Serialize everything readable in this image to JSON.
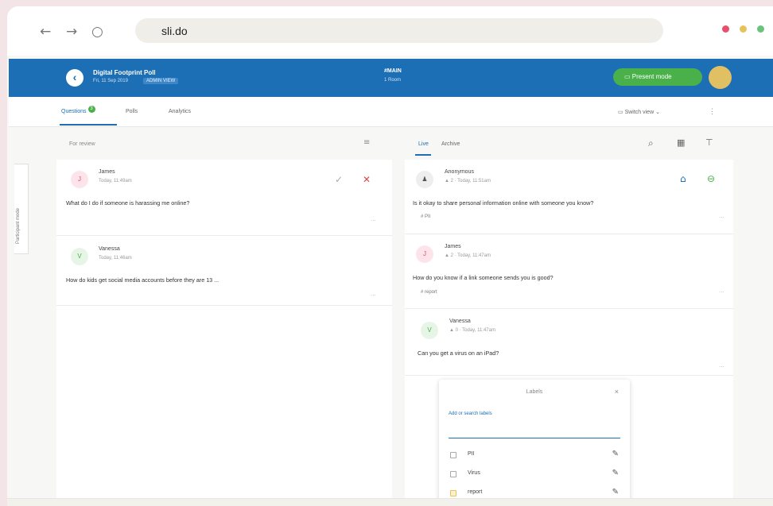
{
  "browser": {
    "url": "sli.do",
    "back_icon": "←",
    "forward_icon": "→",
    "reload_icon": "○",
    "window_dots": [
      "#e8506a",
      "#e6c35a",
      "#69c37a"
    ]
  },
  "header": {
    "event_title": "Digital Footprint Poll",
    "event_date": "Fri, 11 Sep 2019",
    "event_badge": "ADMIN VIEW",
    "event_code": "#MAIN",
    "event_code_sub": "1 Room",
    "present_label": "Present mode",
    "back_icon": "‹"
  },
  "tabs": {
    "questions": "Questions",
    "questions_count": "3",
    "polls": "Polls",
    "analytics": "Analytics",
    "switch_view": "Switch view",
    "more": "⋮"
  },
  "participant_mode": "Participant mode",
  "review": {
    "header": "For review",
    "questions": [
      {
        "avatar": "J",
        "name": "James",
        "meta": "Today, 11:49am",
        "text": "What do I do if someone is harassing me online?",
        "more": "..."
      },
      {
        "avatar": "V",
        "name": "Vanessa",
        "meta": "Today, 11:46am",
        "text": "How do kids get social media accounts before they are 13 ...",
        "more": "..."
      }
    ]
  },
  "live": {
    "tab_live": "Live",
    "tab_archive": "Archive",
    "questions": [
      {
        "avatar": "♟",
        "name": "Anonymous",
        "meta": "▲ 2 · Today, 11:51am",
        "text": "Is it okay to share personal information online with someone you know?",
        "tag": "# PII",
        "more": "..."
      },
      {
        "avatar": "J",
        "name": "James",
        "meta": "▲ 2 · Today, 11:47am",
        "text": "How do you know if a link someone sends you is good?",
        "tag": "# report",
        "more": "..."
      },
      {
        "avatar": "V",
        "name": "Vanessa",
        "meta": "▲ 0 · Today, 11:47am",
        "text": "Can you get a virus on an iPad?",
        "tag": "",
        "more": "..."
      }
    ]
  },
  "labels_popover": {
    "title": "Labels",
    "close": "×",
    "search_placeholder": "Add or search labels",
    "items": [
      {
        "label": "PII",
        "edit_icon": "✎"
      },
      {
        "label": "Virus",
        "edit_icon": "✎"
      },
      {
        "label": "report",
        "edit_icon": "✎"
      }
    ]
  },
  "colors": {
    "header_blue": "#1c6eb5",
    "present_green": "#49b04a",
    "avatar_yellow": "#e0c063"
  }
}
